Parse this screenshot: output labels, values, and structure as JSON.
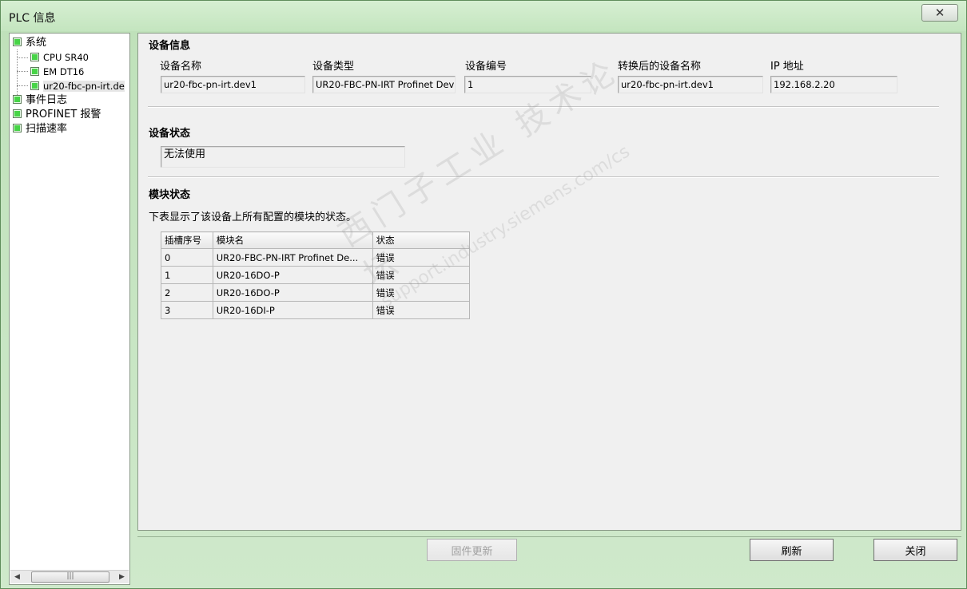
{
  "window": {
    "title": "PLC 信息",
    "close_glyph": "✕"
  },
  "tree": {
    "items": [
      {
        "label": "系统"
      },
      {
        "label": "CPU SR40"
      },
      {
        "label": "EM DT16"
      },
      {
        "label": "ur20-fbc-pn-irt.de"
      },
      {
        "label": "事件日志"
      },
      {
        "label": "PROFINET 报警"
      },
      {
        "label": "扫描速率"
      }
    ]
  },
  "device_info": {
    "section_title": "设备信息",
    "fields": [
      {
        "label": "设备名称",
        "value": "ur20-fbc-pn-irt.dev1"
      },
      {
        "label": "设备类型",
        "value": "UR20-FBC-PN-IRT Profinet Dev"
      },
      {
        "label": "设备编号",
        "value": "1"
      },
      {
        "label": "转换后的设备名称",
        "value": "ur20-fbc-pn-irt.dev1"
      },
      {
        "label": "IP 地址",
        "value": "192.168.2.20"
      }
    ]
  },
  "device_status": {
    "section_title": "设备状态",
    "value": "无法使用"
  },
  "module_status": {
    "section_title": "模块状态",
    "description": "下表显示了该设备上所有配置的模块的状态。",
    "columns": [
      "插槽序号",
      "模块名",
      "状态"
    ],
    "rows": [
      [
        "0",
        "UR20-FBC-PN-IRT Profinet De...",
        "错误"
      ],
      [
        "1",
        "UR20-16DO-P",
        "错误"
      ],
      [
        "2",
        "UR20-16DO-P",
        "错误"
      ],
      [
        "3",
        "UR20-16DI-P",
        "错误"
      ]
    ]
  },
  "buttons": {
    "firmware_update": "固件更新",
    "refresh": "刷新",
    "close": "关闭"
  },
  "watermark": {
    "line1": "西门子工业 技术论坛",
    "line2": "support.industry.siemens.com/cs"
  }
}
